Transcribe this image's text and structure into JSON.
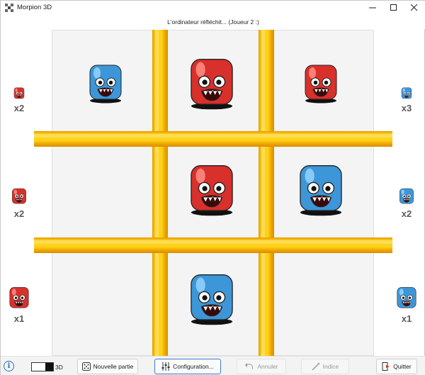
{
  "window": {
    "title": "Morpion 3D"
  },
  "status": "L'ordinateur réfléchit... (Joueur 2 :)",
  "board": [
    [
      "blue",
      "red",
      "red"
    ],
    [
      "",
      "red",
      "blue"
    ],
    [
      "",
      "blue",
      ""
    ]
  ],
  "colors": {
    "red": "#d8302b",
    "blue": "#3d96d8",
    "bar": "#ffd21a"
  },
  "left_counts": [
    {
      "color": "red",
      "size": "small",
      "count": "x2"
    },
    {
      "color": "red",
      "size": "medium",
      "count": "x2"
    },
    {
      "color": "red",
      "size": "large",
      "count": "x1"
    }
  ],
  "right_counts": [
    {
      "color": "blue",
      "size": "small",
      "count": "x3"
    },
    {
      "color": "blue",
      "size": "medium",
      "count": "x2"
    },
    {
      "color": "blue",
      "size": "large",
      "count": "x1"
    }
  ],
  "toolbar": {
    "info_icon": "i",
    "mode_label": "3D",
    "new_game": "Nouvelle partie",
    "config": "Configuration...",
    "undo": "Annuler",
    "hint": "Indice",
    "quit": "Quitter"
  }
}
